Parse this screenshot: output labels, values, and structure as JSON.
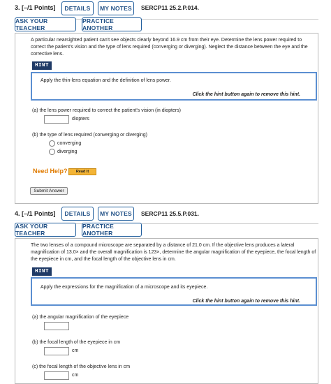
{
  "q3": {
    "number_points": "3. [–/1 Points]",
    "details_label": "DETAILS",
    "notes_label": "MY NOTES",
    "code": "SERCP11 25.2.P.014.",
    "ask_teacher_label": "ASK YOUR TEACHER",
    "practice_label": "PRACTICE ANOTHER",
    "problem_text": "A particular nearsighted patient can't see objects clearly beyond 16.9 cm from their eye. Determine the lens power required to correct the patient's vision and the type of lens required (converging or diverging). Neglect the distance between the eye and the corrective lens.",
    "hint_label": "HINT",
    "hint_text": "Apply the thin-lens equation and the definition of lens power.",
    "hint_remove": "Click the hint button again to remove this hint.",
    "part_a": "(a)   the lens power required to correct the patient's vision (in diopters)",
    "part_a_unit": "diopters",
    "part_b": "(b)   the type of lens required (converging or diverging)",
    "option_1": "converging",
    "option_2": "diverging",
    "need_help": "Need Help?",
    "read_it": "Read It",
    "submit": "Submit Answer"
  },
  "q4": {
    "number_points": "4. [–/1 Points]",
    "details_label": "DETAILS",
    "notes_label": "MY NOTES",
    "code": "SERCP11 25.5.P.031.",
    "ask_teacher_label": "ASK YOUR TEACHER",
    "practice_label": "PRACTICE ANOTHER",
    "problem_text": "The two lenses of a compound microscope are separated by a distance of 21.0 cm. If the objective lens produces a lateral magnification of 13.0× and the overall magnification is 123×, determine the angular magnification of the eyepiece, the focal length of the eyepiece in cm, and the focal length of the objective lens in cm.",
    "hint_label": "HINT",
    "hint_text": "Apply the expressions for the magnification of a microscope and its eyepiece.",
    "hint_remove": "Click the hint button again to remove this hint.",
    "part_a": "(a)   the angular magnification of the eyepiece",
    "part_b": "(b)   the focal length of the eyepiece in cm",
    "part_b_unit": "cm",
    "part_c": "(c)   the focal length of the objective lens in cm",
    "part_c_unit": "cm"
  }
}
